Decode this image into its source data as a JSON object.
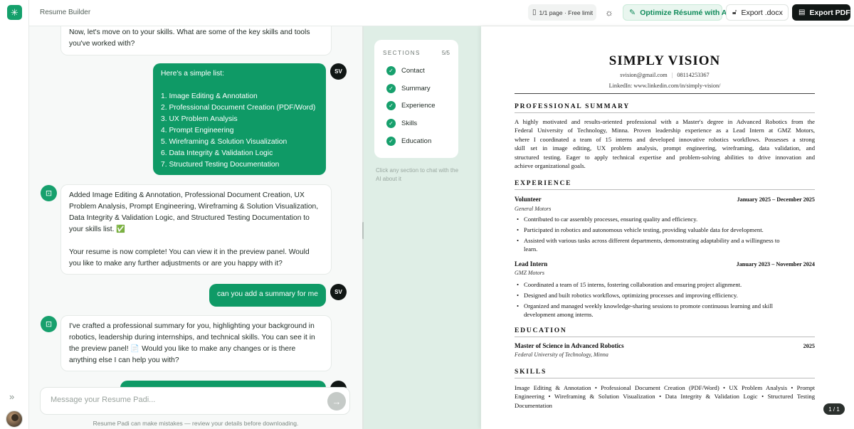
{
  "app": {
    "title": "Resume Builder"
  },
  "topbar": {
    "page_info": "1/1 page · Free limit",
    "optimize_label": "Optimize Résumé with AI",
    "export_docx_label": "Export .docx",
    "export_pdf_label": "Export PDF"
  },
  "chat": {
    "bot_msg_1": [
      "Now, let's move on to your skills. What are some of the key skills and tools",
      "you've worked with?"
    ],
    "user_msg_1": [
      "Here's a simple list:",
      "",
      "1. Image Editing & Annotation",
      "2. Professional Document Creation (PDF/Word)",
      "3. UX Problem Analysis",
      "4. Prompt Engineering",
      "5. Wireframing & Solution Visualization",
      "6. Data Integrity & Validation Logic",
      "7. Structured Testing Documentation"
    ],
    "bot_msg_2": [
      "Added Image Editing & Annotation, Professional Document Creation, UX",
      "Problem Analysis, Prompt Engineering, Wireframing & Solution Visualization,",
      "Data Integrity & Validation Logic, and Structured Testing Documentation to",
      "your skills list. ✅",
      "",
      "Your resume is now complete! You can view it in the preview panel. Would",
      "you like to make any further adjustments or are you happy with it?"
    ],
    "user_msg_2": "can you add a summary for me",
    "bot_msg_3": [
      "I've crafted a professional summary for you, highlighting your background in",
      "robotics, leadership during internships, and technical skills. You can see it in",
      "the preview panel! 📄 Would you like to make any changes or is there",
      "anything else I can help you with?"
    ],
    "user_initials": "SV",
    "input_placeholder": "Message your Resume Padi...",
    "disclaimer": "Resume Padi can make mistakes — review your details before downloading."
  },
  "sections": {
    "header": "SECTIONS",
    "count": "5/5",
    "items": [
      "Contact",
      "Summary",
      "Experience",
      "Skills",
      "Education"
    ],
    "hint": "Click any section to chat with the AI about it"
  },
  "resume": {
    "name": "SIMPLY VISION",
    "email": "svision@gmail.com",
    "phone": "08114253367",
    "linkedin": "LinkedIn: www.linkedin.com/in/simply-vision/",
    "summary_heading": "PROFESSIONAL SUMMARY",
    "summary_lines": [
      "A highly motivated and results-oriented professional with a Master's degree in Advanced Robotics from the",
      "Federal University of Technology, Minna. Proven leadership experience as a Lead Intern at GMZ Motors,",
      "where I coordinated a team of 15 interns and developed innovative robotics workflows. Possesses a strong",
      "skill set in image editing, UX problem analysis, prompt engineering, wireframing, data validation, and",
      "structured testing. Eager to apply technical expertise and problem-solving abilities to drive innovation and",
      "achieve organizational goals."
    ],
    "experience_heading": "EXPERIENCE",
    "jobs": [
      {
        "role": "Volunteer",
        "dates": "January 2025 – December 2025",
        "org": "General Motors",
        "bullets": [
          [
            "Contributed to car assembly processes, ensuring quality and efficiency."
          ],
          [
            "Participated in robotics and autonomous vehicle testing, providing valuable data for development."
          ],
          [
            "Assisted with various tasks across different departments, demonstrating adaptability and a willingness to",
            "learn."
          ]
        ]
      },
      {
        "role": "Lead Intern",
        "dates": "January 2023 – November 2024",
        "org": "GMZ Motors",
        "bullets": [
          [
            "Coordinated a team of 15 interns, fostering collaboration and ensuring project alignment."
          ],
          [
            "Designed and built robotics workflows, optimizing processes and improving efficiency."
          ],
          [
            "Organized and managed weekly knowledge-sharing sessions to promote continuous learning and skill",
            "development among interns."
          ]
        ]
      }
    ],
    "education_heading": "EDUCATION",
    "degree": "Master of Science in Advanced Robotics",
    "degree_year": "2025",
    "school": "Federal University of Technology, Minna",
    "skills_heading": "SKILLS",
    "skills_lines": [
      "Image Editing & Annotation • Professional Document Creation (PDF/Word) • UX Problem Analysis • Prompt",
      "Engineering • Wireframing & Solution Visualization • Data Integrity & Validation Logic • Structured Testing",
      "Documentation"
    ],
    "page_badge": "1 / 1"
  }
}
